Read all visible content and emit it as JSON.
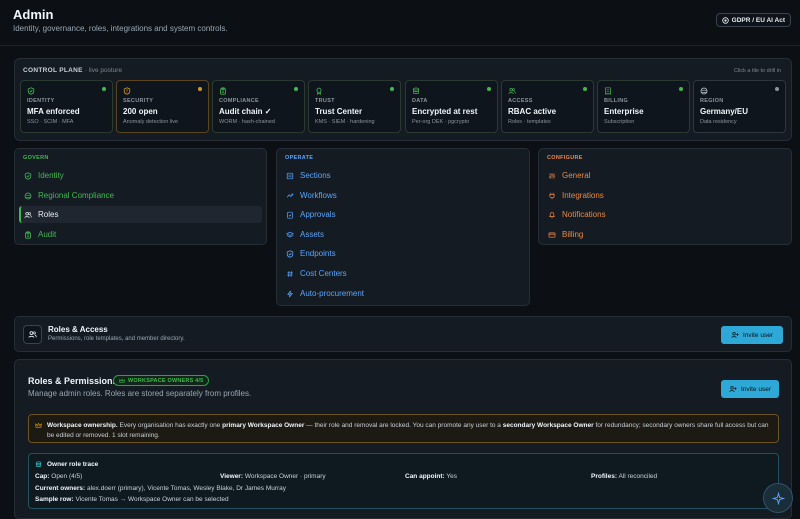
{
  "header": {
    "title": "Admin",
    "subtitle": "Identity, governance, roles, integrations and system controls.",
    "badge": "GDPR / EU AI Act"
  },
  "control_plane": {
    "title": "CONTROL PLANE",
    "title_suffix": "· live posture",
    "hint": "Click a tile to drill in",
    "tiles": [
      {
        "label": "IDENTITY",
        "value": "MFA enforced",
        "sub": "SSO · SCIM · MFA",
        "status": "green",
        "icon": "shield-icon"
      },
      {
        "label": "SECURITY",
        "value": "200 open",
        "sub": "Anomaly detection live",
        "status": "amber",
        "icon": "shield-warning-icon"
      },
      {
        "label": "COMPLIANCE",
        "value": "Audit chain ✓",
        "sub": "WORM · hash-chained",
        "status": "green",
        "icon": "clipboard-icon"
      },
      {
        "label": "TRUST",
        "value": "Trust Center",
        "sub": "KMS · SIEM · hardening",
        "status": "green",
        "icon": "badge-icon"
      },
      {
        "label": "DATA",
        "value": "Encrypted at rest",
        "sub": "Per-org DEK · pgcrypto",
        "status": "green",
        "icon": "database-icon"
      },
      {
        "label": "ACCESS",
        "value": "RBAC active",
        "sub": "Roles · templates",
        "status": "green",
        "icon": "users-icon"
      },
      {
        "label": "BILLING",
        "value": "Enterprise",
        "sub": "Subscription",
        "status": "green",
        "icon": "receipt-icon"
      },
      {
        "label": "REGION",
        "value": "Germany/EU",
        "sub": "Data residency",
        "status": "gray",
        "icon": "globe-icon"
      }
    ]
  },
  "nav": {
    "govern": {
      "heading": "GOVERN",
      "items": [
        {
          "label": "Identity",
          "icon": "shield-icon"
        },
        {
          "label": "Regional Compliance",
          "icon": "globe-icon"
        },
        {
          "label": "Roles",
          "icon": "users-icon",
          "active": true
        },
        {
          "label": "Audit",
          "icon": "clipboard-icon"
        }
      ]
    },
    "operate": {
      "heading": "OPERATE",
      "items": [
        {
          "label": "Sections",
          "icon": "list-icon"
        },
        {
          "label": "Workflows",
          "icon": "workflow-icon"
        },
        {
          "label": "Approvals",
          "icon": "check-doc-icon"
        },
        {
          "label": "Assets",
          "icon": "layers-icon"
        },
        {
          "label": "Endpoints",
          "icon": "shield-icon"
        },
        {
          "label": "Cost Centers",
          "icon": "hash-icon"
        },
        {
          "label": "Auto-procurement",
          "icon": "bolt-icon"
        }
      ]
    },
    "configure": {
      "heading": "CONFIGURE",
      "items": [
        {
          "label": "General",
          "icon": "sliders-icon"
        },
        {
          "label": "Integrations",
          "icon": "plug-icon"
        },
        {
          "label": "Notifications",
          "icon": "bell-icon"
        },
        {
          "label": "Billing",
          "icon": "card-icon"
        }
      ]
    }
  },
  "roles_access": {
    "title": "Roles & Access",
    "subtitle": "Permissions, role templates, and member directory.",
    "button": "Invite user"
  },
  "roles_permissions": {
    "title": "Roles & Permissions",
    "badge": "WORKSPACE OWNERS 4/5",
    "subtitle": "Manage admin roles. Roles are stored separately from profiles.",
    "button": "Invite user",
    "ownership": {
      "lead": "Workspace ownership.",
      "t1": " Every organisation has exactly one ",
      "b1": "primary Workspace Owner",
      "t2": " — their role and removal are locked. You can promote any user to a ",
      "b2": "secondary Workspace Owner",
      "t3": " for redundancy; secondary owners share full access but can be edited or removed. 1 slot remaining."
    },
    "trace": {
      "title": "Owner role trace",
      "cap_label": "Cap:",
      "cap_value": " Open (4/5)",
      "viewer_label": "Viewer:",
      "viewer_value": " Workspace Owner · primary",
      "appoint_label": "Can appoint:",
      "appoint_value": " Yes",
      "profiles_label": "Profiles:",
      "profiles_value": " All reconciled",
      "owners_label": "Current owners:",
      "owners_value": " alex.doerr (primary), Vicente Tomas, Wesley Blake, Dr James Murray",
      "sample_label": "Sample row:",
      "sample_value": " Vicente Tomas → Workspace Owner can be selected"
    }
  }
}
